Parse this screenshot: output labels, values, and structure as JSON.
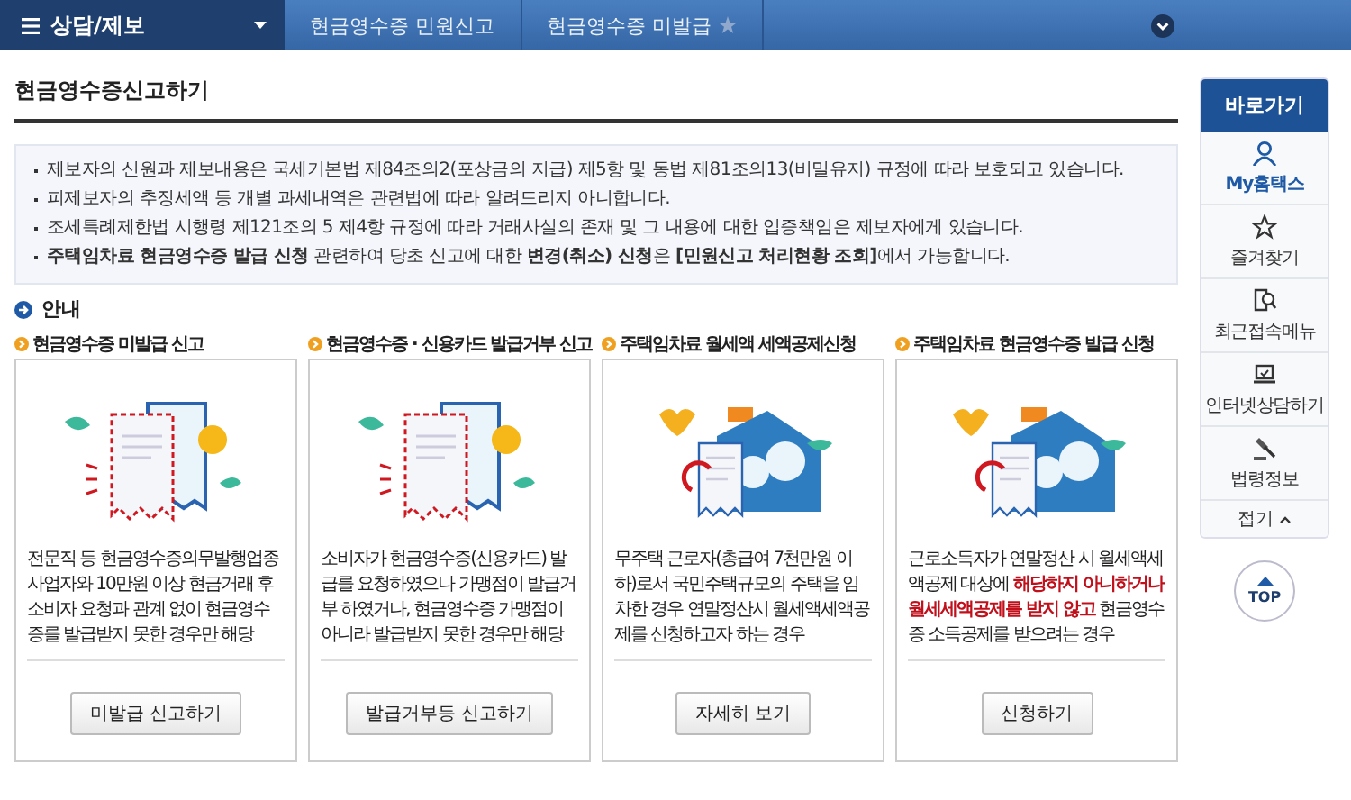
{
  "nav": {
    "menu_label": "상담/제보",
    "crumbs": [
      {
        "label": "현금영수증 민원신고",
        "starred": false
      },
      {
        "label": "현금영수증 미발급",
        "starred": true
      }
    ]
  },
  "page_title": "현금영수증신고하기",
  "notices": [
    "제보자의 신원과 제보내용은 국세기본법 제84조의2(포상금의 지급) 제5항 및 동법 제81조의13(비밀유지) 규정에 따라 보호되고 있습니다.",
    "피제보자의 추징세액 등 개별 과세내역은 관련법에 따라 알려드리지 아니합니다.",
    "조세특례제한법 시행령 제121조의 5 제4항 규정에 따라 거래사실의 존재 및 그 내용에 대한 입증책임은 제보자에게 있습니다.",
    "**주택임차료 현금영수증 발급 신청** 관련하여 당초 신고에 대한 **변경(취소) 신청**은 **[민원신고 처리현황 조회]**에서 가능합니다."
  ],
  "section_title": "안내",
  "cards": [
    {
      "title": "현금영수증 미발급 신고",
      "kind": "receipt",
      "description": "전문직 등 현금영수증의무발행업종 사업자와 10만원 이상 현금거래 후 소비자 요청과 관계 없이 현금영수증를 발급받지 못한 경우만 해당",
      "button": "미발급 신고하기"
    },
    {
      "title": "현금영수증 · 신용카드 발급거부 신고",
      "kind": "receipt",
      "description": "소비자가 현금영수증(신용카드) 발급를 요청하였으나 가맹점이 발급거부 하였거나, 현금영수증 가맹점이 아니라 발급받지 못한 경우만 해당",
      "button": "발급거부등 신고하기"
    },
    {
      "title": "주택임차료 월세액 세액공제신청",
      "kind": "house",
      "description": "무주택 근로자(총급여 7천만원 이하)로서 국민주택규모의 주택을 임차한 경우 연말정산시 월세액세액공제를 신청하고자 하는 경우",
      "button": "자세히 보기"
    },
    {
      "title": "주택임차료 현금영수증 발급 신청",
      "kind": "house",
      "description": "근로소득자가 연말정산 시 월세액세액공제 대상에 **해당하지 아니하거나 월세세액공제를 받지 않고** 현금영수증 소득공제를 받으려는 경우",
      "button": "신청하기"
    }
  ],
  "quick": {
    "title": "바로가기",
    "items": [
      {
        "label": "My홈택스",
        "kind": "person",
        "highlighted": true
      },
      {
        "label": "즐겨찾기",
        "kind": "star",
        "highlighted": false
      },
      {
        "label": "최근접속메뉴",
        "kind": "search",
        "highlighted": false
      },
      {
        "label": "인터넷상담하기",
        "kind": "laptop",
        "highlighted": false
      },
      {
        "label": "법령정보",
        "kind": "gavel",
        "highlighted": false
      }
    ],
    "collapse": "접기",
    "top": "TOP"
  }
}
